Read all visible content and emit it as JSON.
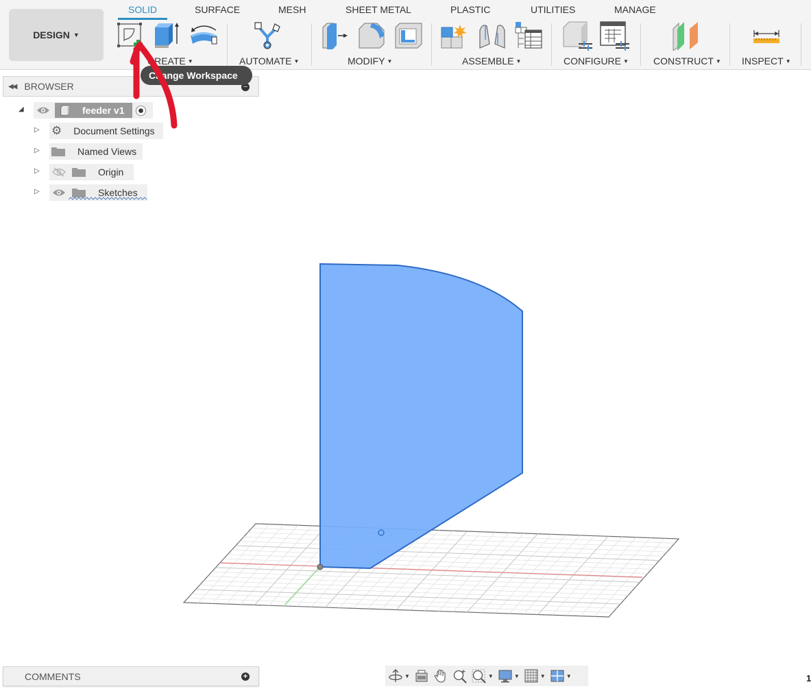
{
  "workspace": {
    "label": "DESIGN"
  },
  "tabs": [
    {
      "label": "SOLID",
      "active": true
    },
    {
      "label": "SURFACE"
    },
    {
      "label": "MESH"
    },
    {
      "label": "SHEET METAL"
    },
    {
      "label": "PLASTIC"
    },
    {
      "label": "UTILITIES"
    },
    {
      "label": "MANAGE"
    }
  ],
  "groups": {
    "create": "CREATE",
    "automate": "AUTOMATE",
    "modify": "MODIFY",
    "assemble": "ASSEMBLE",
    "configure": "CONFIGURE",
    "construct": "CONSTRUCT",
    "inspect": "INSPECT"
  },
  "tooltip": {
    "text": "Change Workspace"
  },
  "browser": {
    "title": "BROWSER",
    "root": {
      "label": "feeder v1"
    },
    "items": [
      {
        "label": "Document Settings",
        "icon": "gear-icon"
      },
      {
        "label": "Named Views",
        "icon": "folder-icon"
      },
      {
        "label": "Origin",
        "icon": "folder-icon",
        "visible": false
      },
      {
        "label": "Sketches",
        "icon": "folder-icon",
        "visible": true
      }
    ]
  },
  "comments": {
    "title": "COMMENTS"
  },
  "navbar": {
    "items": [
      "orbit-icon",
      "look-at-icon",
      "pan-icon",
      "zoom-icon",
      "zoom-window-icon",
      "display-settings-icon",
      "grid-settings-icon",
      "viewports-icon"
    ]
  },
  "corner_text": "1",
  "colors": {
    "accent": "#2c8fc1",
    "body_fill": "#75aefc",
    "body_edge": "#2f6bc4",
    "annotation": "#e0182d"
  }
}
